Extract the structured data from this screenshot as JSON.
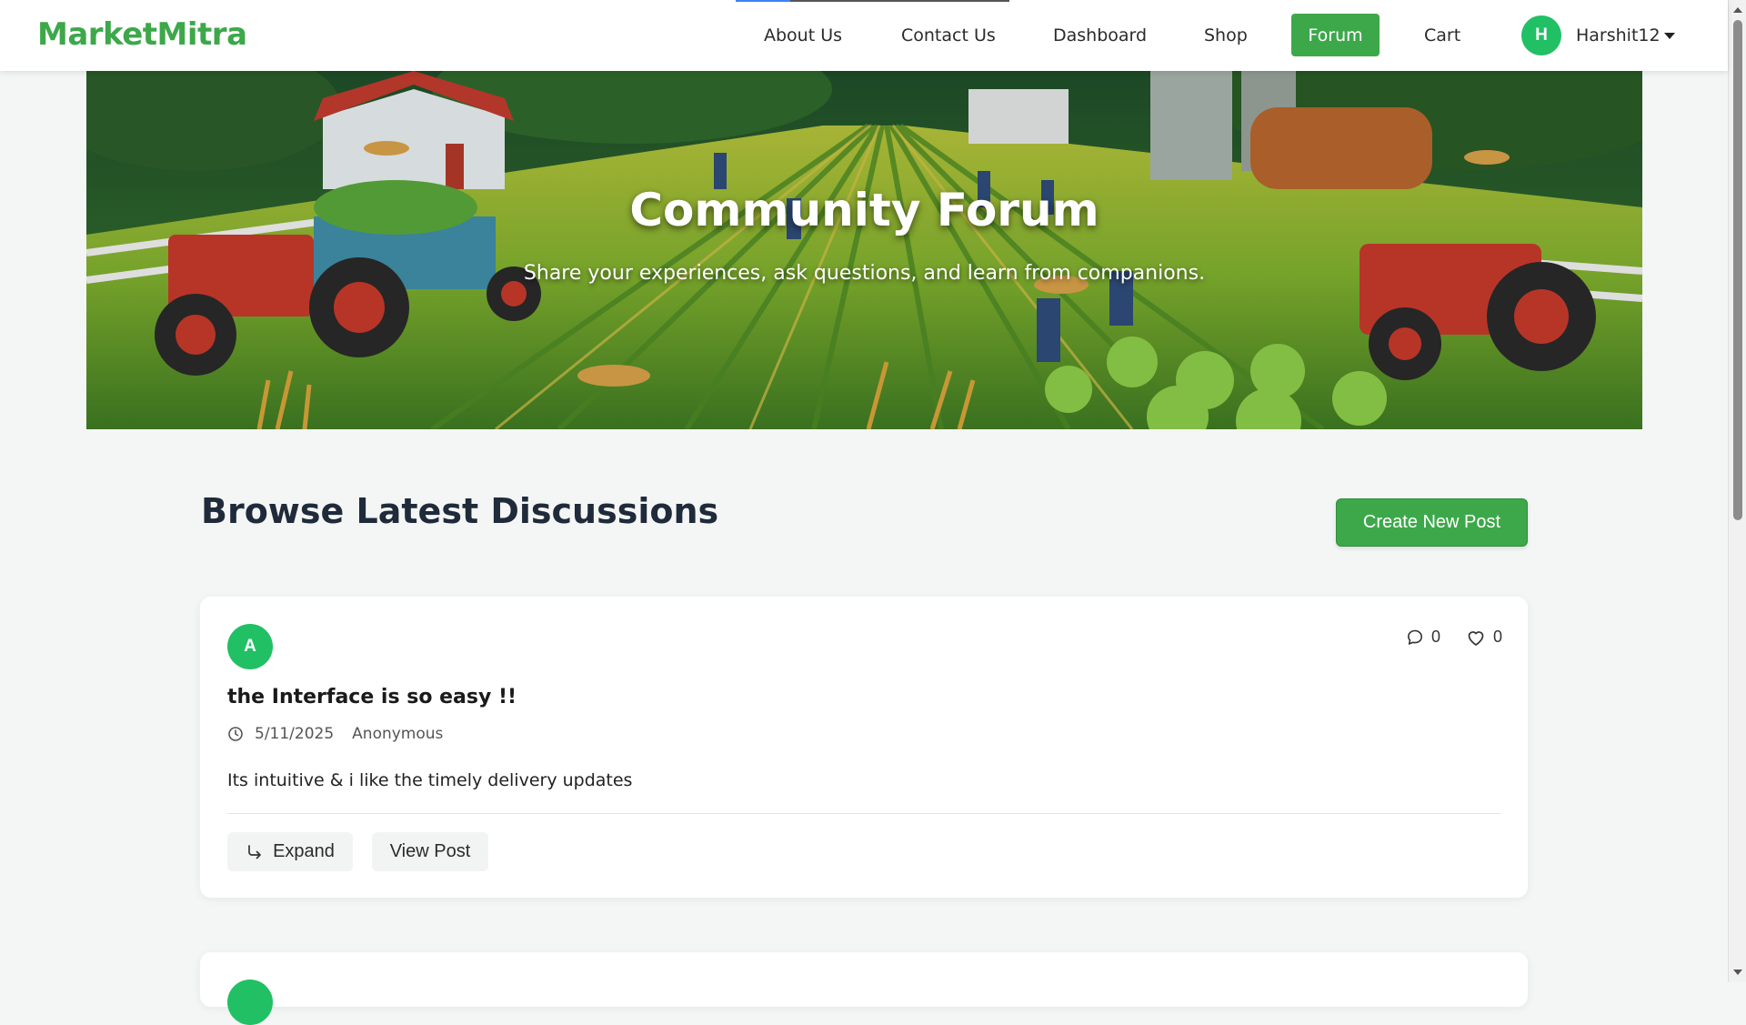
{
  "brand": {
    "name": "MarketMitra",
    "color": "#3da84a"
  },
  "nav": {
    "about": "About Us",
    "contact": "Contact Us",
    "dashboard": "Dashboard",
    "shop": "Shop",
    "forum": "Forum",
    "cart": "Cart"
  },
  "user": {
    "initial": "H",
    "name": "Harshit12",
    "avatar_color": "#21c065"
  },
  "hero": {
    "title": "Community Forum",
    "subtitle": "Share your experiences, ask questions, and learn from companions."
  },
  "section": {
    "title": "Browse Latest Discussions",
    "create_label": "Create New Post"
  },
  "posts": [
    {
      "initial": "A",
      "title": "the Interface is so easy !!",
      "date": "5/11/2025",
      "author": "Anonymous",
      "body": "Its intuitive & i like the timely delivery updates",
      "comments": "0",
      "likes": "0",
      "expand_label": "Expand",
      "view_label": "View Post"
    }
  ],
  "colors": {
    "accent": "#3da84a",
    "avatar": "#21c065",
    "page_bg": "#f4f6f5"
  },
  "icons": [
    "caret-down-icon",
    "comment-icon",
    "heart-icon",
    "clock-icon",
    "reply-arrow-icon"
  ]
}
